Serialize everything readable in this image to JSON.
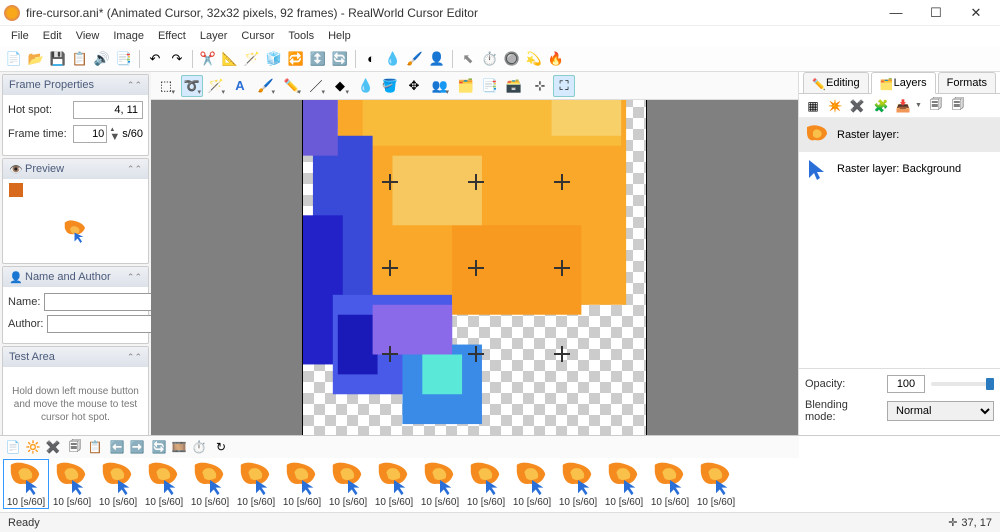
{
  "window": {
    "title": "fire-cursor.ani* (Animated Cursor, 32x32 pixels, 92 frames) - RealWorld Cursor Editor",
    "minimize": "—",
    "maximize": "☐",
    "close": "✕"
  },
  "menu": [
    "File",
    "Edit",
    "View",
    "Image",
    "Effect",
    "Layer",
    "Cursor",
    "Tools",
    "Help"
  ],
  "panels": {
    "frame_properties": {
      "title": "Frame Properties",
      "hotspot_label": "Hot spot:",
      "hotspot_value": "4, 11",
      "frametime_label": "Frame time:",
      "frametime_value": "10",
      "frametime_unit": "s/60"
    },
    "preview": {
      "title": "Preview"
    },
    "name_author": {
      "title": "Name and Author",
      "name_label": "Name:",
      "author_label": "Author:",
      "name_value": "",
      "author_value": ""
    },
    "test_area": {
      "title": "Test Area",
      "hint": "Hold down left mouse button and move the mouse to test cursor hot spot."
    }
  },
  "right": {
    "tabs": {
      "editing": "Editing",
      "layers": "Layers",
      "formats": "Formats"
    },
    "layers": [
      {
        "label": "Raster layer:"
      },
      {
        "label": "Raster layer: Background"
      }
    ],
    "opacity_label": "Opacity:",
    "opacity_value": "100",
    "blending_label": "Blending mode:",
    "blending_value": "Normal"
  },
  "frames": {
    "labels": [
      "10 [s/60]",
      "10 [s/60]",
      "10 [s/60]",
      "10 [s/60]",
      "10 [s/60]",
      "10 [s/60]",
      "10 [s/60]",
      "10 [s/60]",
      "10 [s/60]",
      "10 [s/60]",
      "10 [s/60]",
      "10 [s/60]",
      "10 [s/60]",
      "10 [s/60]",
      "10 [s/60]",
      "10 [s/60]"
    ]
  },
  "status": {
    "ready": "Ready",
    "coords": "37, 17"
  }
}
